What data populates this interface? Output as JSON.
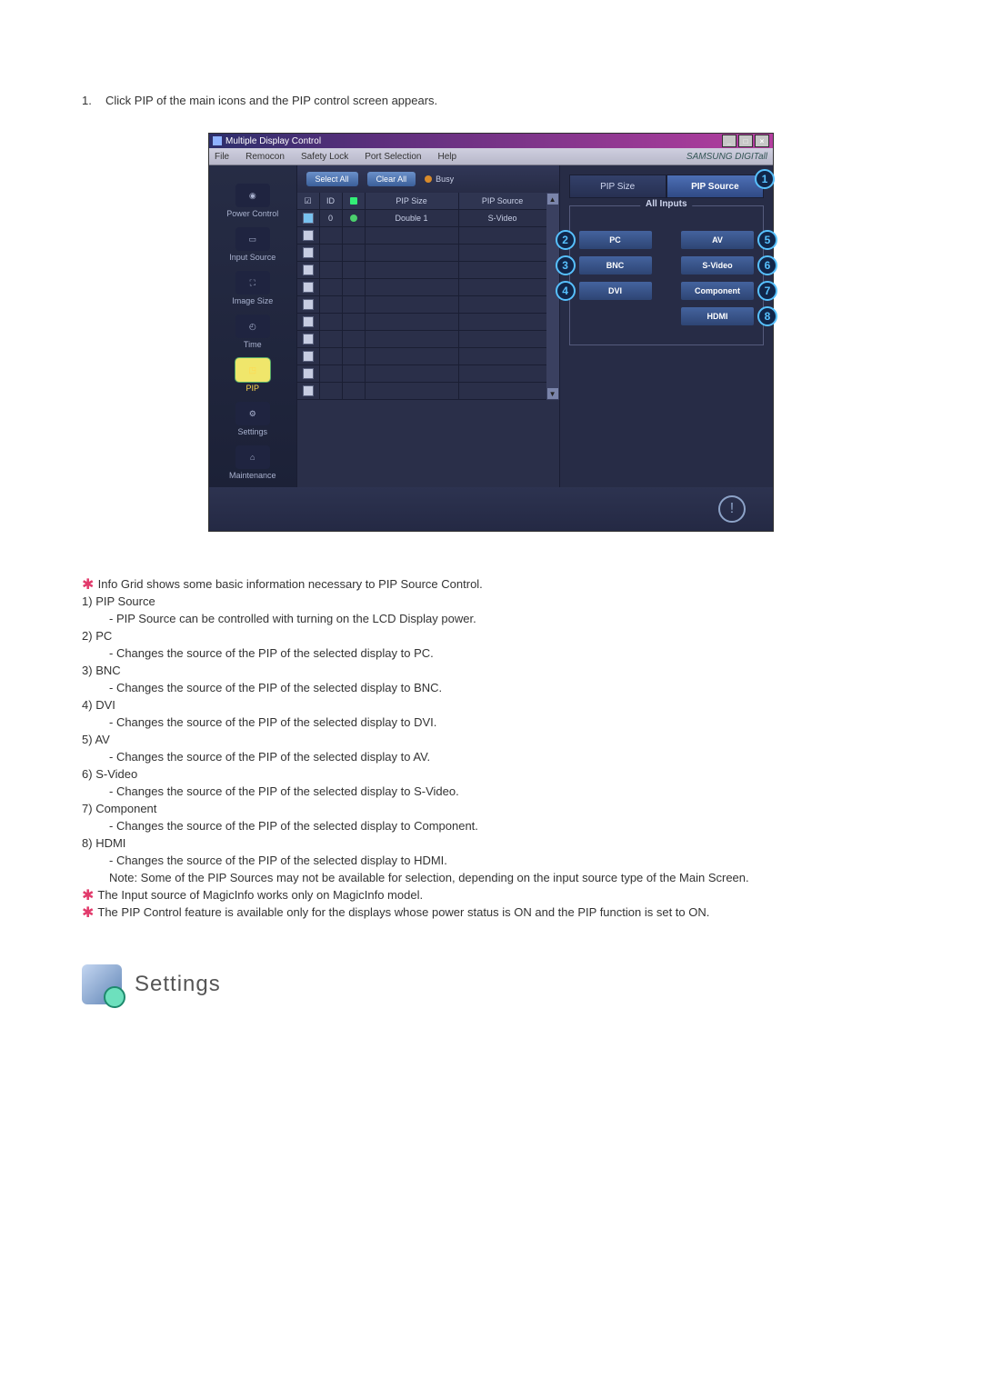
{
  "intro_number": "1.",
  "intro_text": "Click PIP of the main icons and the PIP control screen appears.",
  "window": {
    "title": "Multiple Display Control",
    "btn_min": "_",
    "btn_max": "□",
    "btn_close": "×"
  },
  "menu": {
    "file": "File",
    "remocon": "Remocon",
    "safety": "Safety Lock",
    "port": "Port Selection",
    "help": "Help",
    "brand": "SAMSUNG DIGITall"
  },
  "sidebar": [
    {
      "label": "Power Control"
    },
    {
      "label": "Input Source"
    },
    {
      "label": "Image Size"
    },
    {
      "label": "Time"
    },
    {
      "label": "PIP"
    },
    {
      "label": "Settings"
    },
    {
      "label": "Maintenance"
    }
  ],
  "buttons": {
    "select_all": "Select All",
    "clear_all": "Clear All",
    "busy": "Busy"
  },
  "headers": {
    "chk": "☑",
    "id": "ID",
    "st": "●",
    "size": "PIP Size",
    "src": "PIP Source"
  },
  "row": {
    "id": "0",
    "size": "Double 1",
    "src": "S-Video"
  },
  "rpanel": {
    "tab_size": "PIP Size",
    "tab_source": "PIP Source",
    "all_inputs": "All Inputs",
    "pc": "PC",
    "bnc": "BNC",
    "dvi": "DVI",
    "av": "AV",
    "svideo": "S-Video",
    "component": "Component",
    "hdmi": "HDMI"
  },
  "callouts": {
    "c1": "1",
    "c2": "2",
    "c3": "3",
    "c4": "4",
    "c5": "5",
    "c6": "6",
    "c7": "7",
    "c8": "8"
  },
  "foot_icon": "!",
  "desc": {
    "star1": "Info Grid shows some basic information necessary to PIP Source Control.",
    "n1": "1)",
    "t1": "PIP Source",
    "d1": "- PIP Source can be controlled with turning on the LCD Display power.",
    "n2": "2)",
    "t2": "PC",
    "d2": "- Changes the source of the PIP of the selected display to PC.",
    "n3": "3)",
    "t3": "BNC",
    "d3": "- Changes the source of the PIP of the selected display to BNC.",
    "n4": "4)",
    "t4": "DVI",
    "d4": "- Changes the source of the PIP of the selected display to DVI.",
    "n5": "5)",
    "t5": "AV",
    "d5": "- Changes the source of the PIP of the selected display to AV.",
    "n6": "6)",
    "t6": "S-Video",
    "d6": "- Changes the source of the PIP of the selected display to S-Video.",
    "n7": "7)",
    "t7": "Component",
    "d7": "- Changes the source of the PIP of the selected display to Component.",
    "n8": "8)",
    "t8": "HDMI",
    "d8": "- Changes the source of the PIP of the selected display to HDMI.",
    "note": "Note: Some of the PIP Sources may not be available for selection, depending on the input source type of the Main Screen.",
    "star2": "The Input source of MagicInfo works only on MagicInfo model.",
    "star3": "The PIP Control feature is available only for the displays whose power status is ON and the PIP function is set to ON."
  },
  "section_title": "Settings"
}
